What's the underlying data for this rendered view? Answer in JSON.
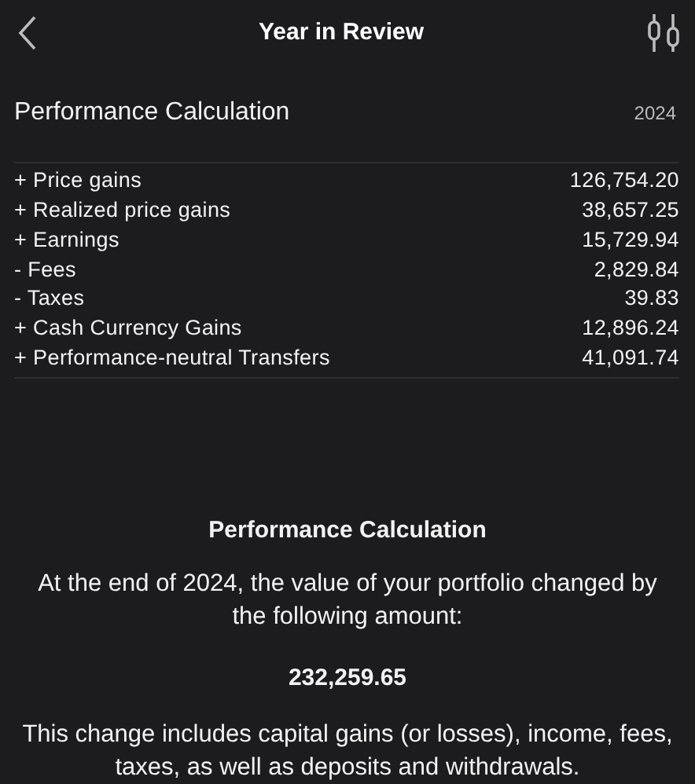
{
  "header": {
    "title": "Year in Review"
  },
  "section": {
    "title": "Performance Calculation",
    "year": "2024"
  },
  "rows": [
    {
      "label": "+ Price gains",
      "value": "126,754.20"
    },
    {
      "label": "+ Realized price gains",
      "value": "38,657.25"
    },
    {
      "label": "+ Earnings",
      "value": "15,729.94"
    },
    {
      "label": "- Fees",
      "value": "2,829.84"
    },
    {
      "label": "- Taxes",
      "value": "39.83"
    },
    {
      "label": "+ Cash Currency Gains",
      "value": "12,896.24"
    },
    {
      "label": "+ Performance-neutral Transfers",
      "value": "41,091.74"
    }
  ],
  "summary": {
    "title": "Performance Calculation",
    "intro": "At the end of 2024, the value of your portfolio changed by the following amount:",
    "amount": "232,259.65",
    "note": "This change includes capital gains (or losses), income, fees, taxes, as well as deposits and withdrawals."
  }
}
